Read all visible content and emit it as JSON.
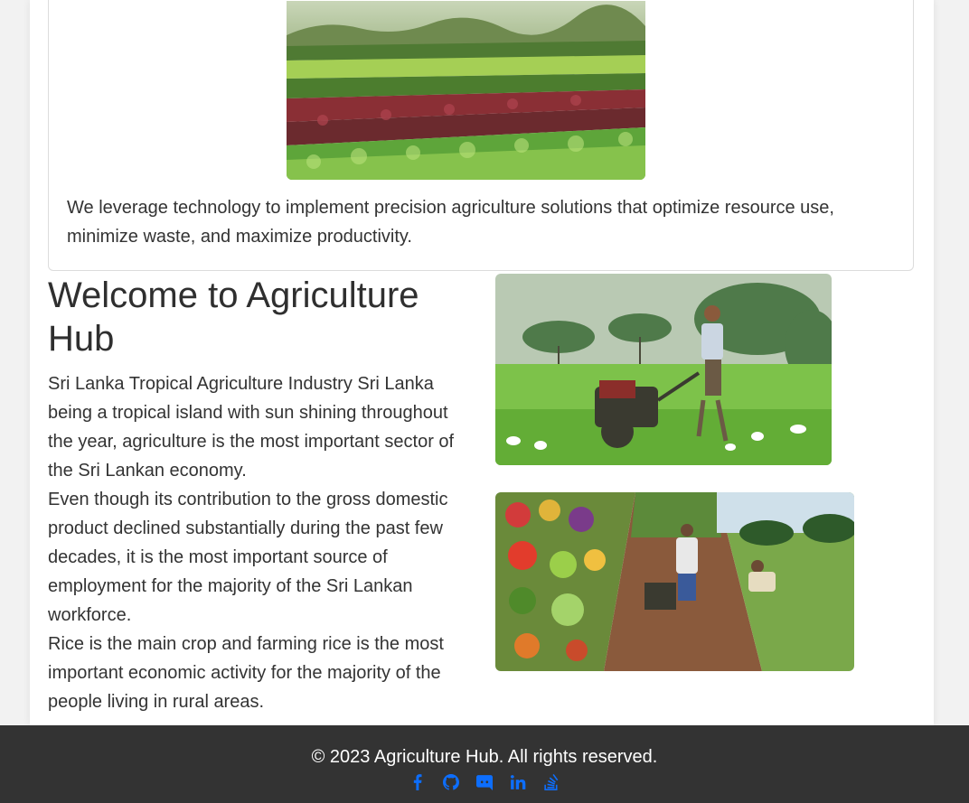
{
  "card": {
    "image_alt": "Rows of lettuce and leafy green crops in a field",
    "text": "We leverage technology to implement precision agriculture solutions that optimize resource use, minimize waste, and maximize productivity."
  },
  "welcome": {
    "title": "Welcome to Agriculture Hub",
    "paragraphs": [
      "Sri Lanka Tropical Agriculture Industry Sri Lanka being a tropical island with sun shining throughout the year, agriculture is the most important sector of the Sri Lankan economy.",
      "Even though its contribution to the gross domestic product declined substantially during the past few decades, it is the most important source of employment for the majority of the Sri Lankan workforce.",
      "Rice is the main crop and farming rice is the most important economic activity for the majority of the people living in rural areas."
    ]
  },
  "images": {
    "farmer_alt": "Farmer operating a two-wheel tractor in a green paddy field",
    "collage_alt": "Collage of vegetables, ploughing and a farmer tending crops"
  },
  "footer": {
    "copyright": "© 2023 Agriculture Hub. All rights reserved.",
    "social": [
      {
        "name": "facebook-icon"
      },
      {
        "name": "github-icon"
      },
      {
        "name": "discord-icon"
      },
      {
        "name": "linkedin-icon"
      },
      {
        "name": "stack-overflow-icon"
      }
    ],
    "link_color": "#0d6efd",
    "background": "#333333"
  }
}
